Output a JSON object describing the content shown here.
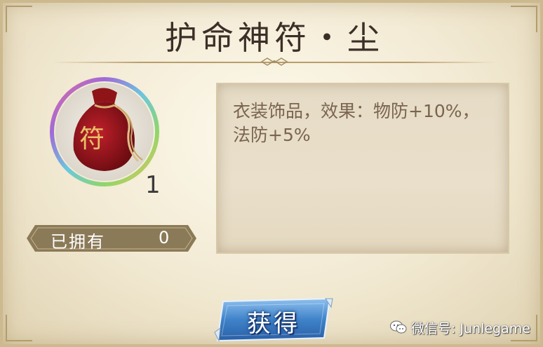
{
  "dialog": {
    "title": "护命神符・尘"
  },
  "item": {
    "icon": "red-talisman-pouch-icon",
    "pouch_glyph": "符",
    "count": "1"
  },
  "owned": {
    "label": "已拥有",
    "value": "0"
  },
  "description": {
    "text": "衣装饰品，效果：物防+10%，法防+5%"
  },
  "actions": {
    "obtain_label": "获得"
  },
  "watermark": {
    "icon": "wechat-icon",
    "text": "微信号: Junlegame"
  },
  "colors": {
    "title": "#3b2f27",
    "owned_bar": "#8b7a58",
    "description_text": "#7a6450",
    "button_blue": "#3f83c9"
  }
}
